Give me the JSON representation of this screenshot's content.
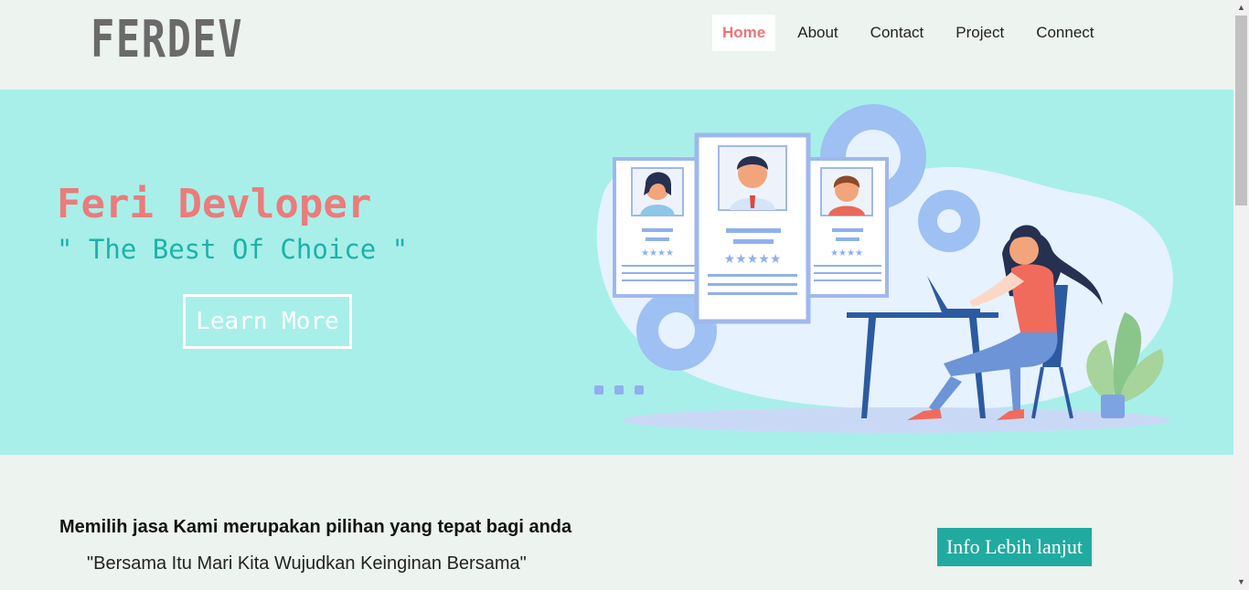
{
  "logo": "FERDEV",
  "nav": {
    "items": [
      {
        "label": "Home",
        "active": true
      },
      {
        "label": "About",
        "active": false
      },
      {
        "label": "Contact",
        "active": false
      },
      {
        "label": "Project",
        "active": false
      },
      {
        "label": "Connect",
        "active": false
      }
    ]
  },
  "hero": {
    "title": "Feri Devloper",
    "subtitle": "\" The Best Of Choice \"",
    "button": "Learn More"
  },
  "info": {
    "title": "Memilih jasa Kami merupakan pilihan yang tepat bagi anda",
    "quote": "\"Bersama Itu Mari Kita Wujudkan Keinginan Bersama\"",
    "button": "Info Lebih lanjut"
  },
  "colors": {
    "accent_coral": "#ec7b7b",
    "accent_teal": "#21aaa0",
    "hero_bg": "#a8efe9",
    "page_bg": "#edf3ef"
  },
  "icons": [
    "chevron-up-icon",
    "chevron-down-icon"
  ]
}
